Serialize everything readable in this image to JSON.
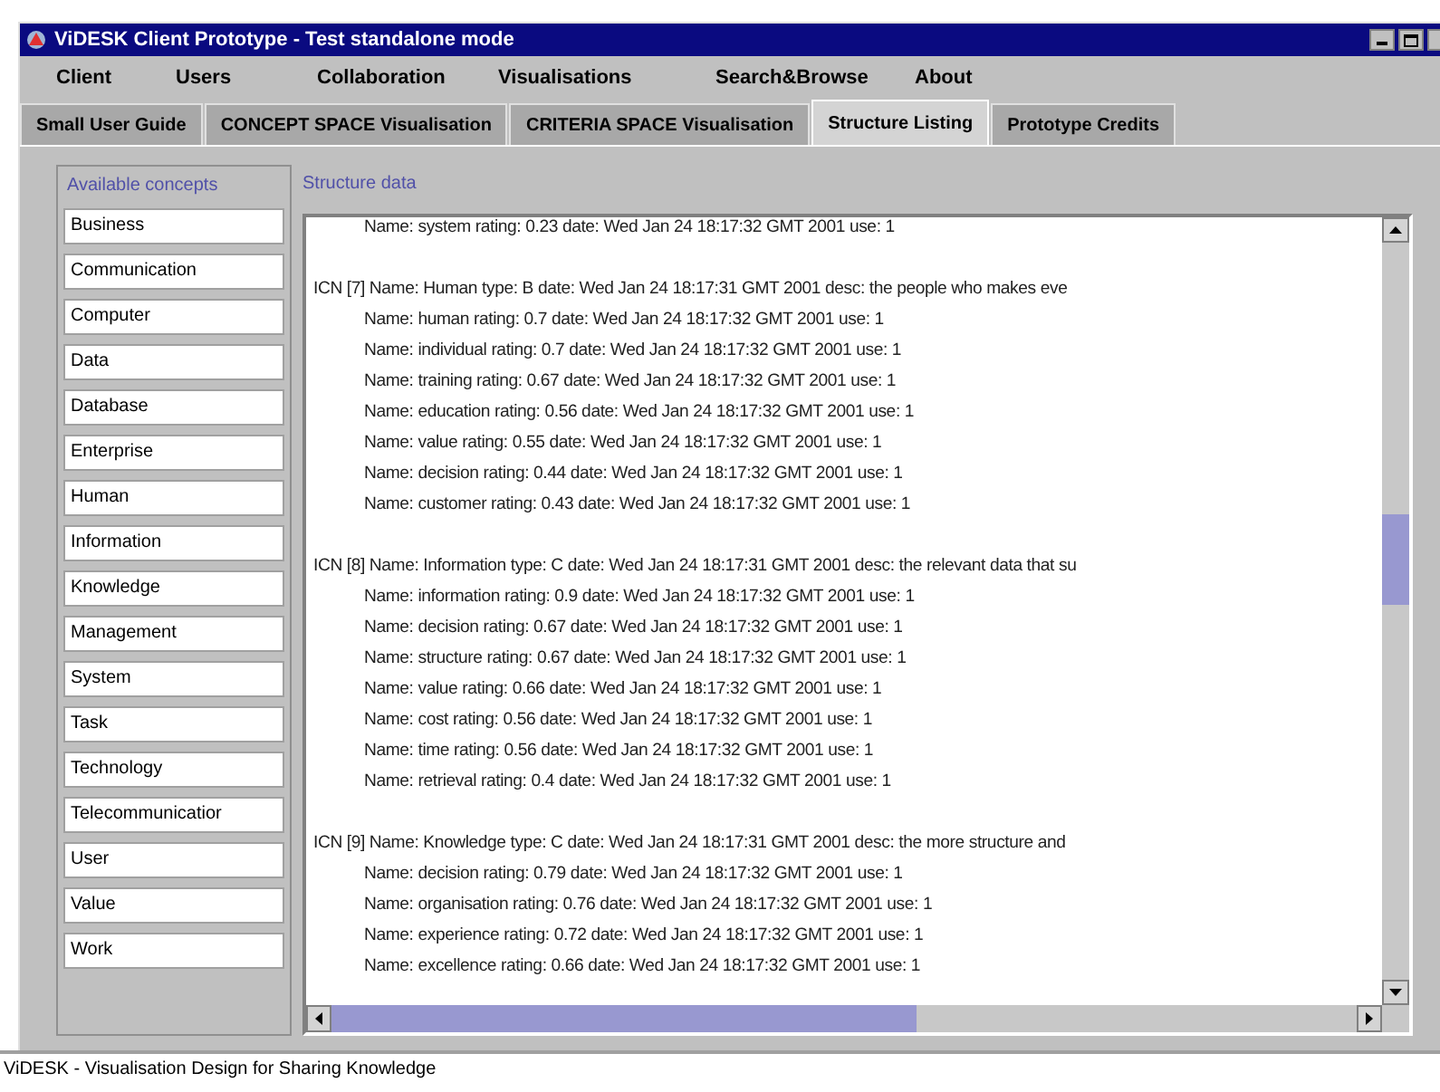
{
  "window": {
    "title": "ViDESK Client Prototype - Test standalone mode"
  },
  "menu": [
    "Client",
    "Users",
    "Collaboration",
    "Visualisations",
    "Search&Browse",
    "About"
  ],
  "tabs": [
    {
      "label": "Small User Guide",
      "selected": false
    },
    {
      "label": "CONCEPT SPACE Visualisation",
      "selected": false
    },
    {
      "label": "CRITERIA SPACE Visualisation",
      "selected": false
    },
    {
      "label": "Structure Listing",
      "selected": true
    },
    {
      "label": "Prototype Credits",
      "selected": false
    }
  ],
  "concepts": {
    "title": "Available concepts",
    "items": [
      "Business",
      "Communication",
      "Computer",
      "Data",
      "Database",
      "Enterprise",
      "Human",
      "Information",
      "Knowledge",
      "Management",
      "System",
      "Task",
      "Technology",
      "Telecommunicatior",
      "User",
      "Value",
      "Work"
    ]
  },
  "structure": {
    "title": "Structure data",
    "lines": [
      {
        "kind": "item",
        "text": "Name: system rating: 0.23 date: Wed Jan 24 18:17:32 GMT 2001 use: 1"
      },
      {
        "kind": "gap"
      },
      {
        "kind": "header",
        "text": "ICN [7] Name: Human type: B date: Wed Jan 24 18:17:31 GMT 2001 desc: the people who makes eve"
      },
      {
        "kind": "item",
        "text": "Name: human rating: 0.7 date: Wed Jan 24 18:17:32 GMT 2001 use: 1"
      },
      {
        "kind": "item",
        "text": "Name: individual rating: 0.7 date: Wed Jan 24 18:17:32 GMT 2001 use: 1"
      },
      {
        "kind": "item",
        "text": "Name: training rating: 0.67 date: Wed Jan 24 18:17:32 GMT 2001 use: 1"
      },
      {
        "kind": "item",
        "text": "Name: education rating: 0.56 date: Wed Jan 24 18:17:32 GMT 2001 use: 1"
      },
      {
        "kind": "item",
        "text": "Name: value rating: 0.55 date: Wed Jan 24 18:17:32 GMT 2001 use: 1"
      },
      {
        "kind": "item",
        "text": "Name: decision rating: 0.44 date: Wed Jan 24 18:17:32 GMT 2001 use: 1"
      },
      {
        "kind": "item",
        "text": "Name: customer rating: 0.43 date: Wed Jan 24 18:17:32 GMT 2001 use: 1"
      },
      {
        "kind": "gap"
      },
      {
        "kind": "header",
        "text": "ICN [8] Name: Information type: C date: Wed Jan 24 18:17:31 GMT 2001 desc: the relevant data that su"
      },
      {
        "kind": "item",
        "text": "Name: information rating: 0.9 date: Wed Jan 24 18:17:32 GMT 2001 use: 1"
      },
      {
        "kind": "item",
        "text": "Name: decision rating: 0.67 date: Wed Jan 24 18:17:32 GMT 2001 use: 1"
      },
      {
        "kind": "item",
        "text": "Name: structure rating: 0.67 date: Wed Jan 24 18:17:32 GMT 2001 use: 1"
      },
      {
        "kind": "item",
        "text": "Name: value rating: 0.66 date: Wed Jan 24 18:17:32 GMT 2001 use: 1"
      },
      {
        "kind": "item",
        "text": "Name: cost rating: 0.56 date: Wed Jan 24 18:17:32 GMT 2001 use: 1"
      },
      {
        "kind": "item",
        "text": "Name: time rating: 0.56 date: Wed Jan 24 18:17:32 GMT 2001 use: 1"
      },
      {
        "kind": "item",
        "text": "Name: retrieval rating: 0.4 date: Wed Jan 24 18:17:32 GMT 2001 use: 1"
      },
      {
        "kind": "gap"
      },
      {
        "kind": "header",
        "text": "ICN [9] Name: Knowledge type: C date: Wed Jan 24 18:17:31 GMT 2001 desc: the more structure and"
      },
      {
        "kind": "item",
        "text": "Name: decision rating: 0.79 date: Wed Jan 24 18:17:32 GMT 2001 use: 1"
      },
      {
        "kind": "item",
        "text": "Name: organisation rating: 0.76 date: Wed Jan 24 18:17:32 GMT 2001 use: 1"
      },
      {
        "kind": "item",
        "text": "Name: experience rating: 0.72 date: Wed Jan 24 18:17:32 GMT 2001 use: 1"
      },
      {
        "kind": "item",
        "text": "Name: excellence rating: 0.66 date: Wed Jan 24 18:17:32 GMT 2001 use: 1"
      }
    ]
  },
  "status_bar": "ViDESK - Visualisation Design for Sharing Knowledge"
}
